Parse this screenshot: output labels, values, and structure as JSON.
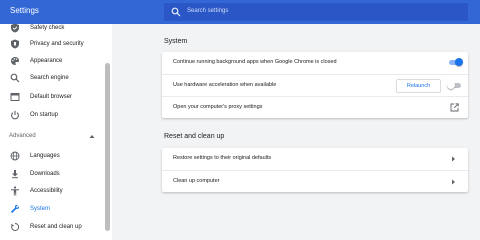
{
  "header": {
    "title": "Settings",
    "search_placeholder": "Search settings"
  },
  "sidebar": {
    "items_top": [
      {
        "label": "Safety check",
        "icon": "shield-icon"
      },
      {
        "label": "Privacy and security",
        "icon": "privacy-shield-icon"
      },
      {
        "label": "Appearance",
        "icon": "palette-icon"
      },
      {
        "label": "Search engine",
        "icon": "search-icon"
      },
      {
        "label": "Default browser",
        "icon": "browser-window-icon"
      },
      {
        "label": "On startup",
        "icon": "power-icon"
      }
    ],
    "advanced_label": "Advanced",
    "items_advanced": [
      {
        "label": "Languages",
        "icon": "globe-icon"
      },
      {
        "label": "Downloads",
        "icon": "download-icon"
      },
      {
        "label": "Accessibility",
        "icon": "accessibility-icon"
      },
      {
        "label": "System",
        "icon": "wrench-icon",
        "active": true
      },
      {
        "label": "Reset and clean up",
        "icon": "reset-icon"
      }
    ]
  },
  "system": {
    "title": "System",
    "rows": [
      {
        "label": "Continue running background apps when Google Chrome is closed",
        "toggle": "on"
      },
      {
        "label": "Use hardware acceleration when available",
        "toggle": "off",
        "button": "Relaunch"
      },
      {
        "label": "Open your computer's proxy settings",
        "icon": "external-link-icon"
      }
    ]
  },
  "reset": {
    "title": "Reset and clean up",
    "rows": [
      {
        "label": "Restore settings to their original defaults"
      },
      {
        "label": "Clean up computer"
      }
    ]
  },
  "colors": {
    "header": "#3367d6",
    "accent": "#1a73e8",
    "background": "#f1f3f4"
  }
}
